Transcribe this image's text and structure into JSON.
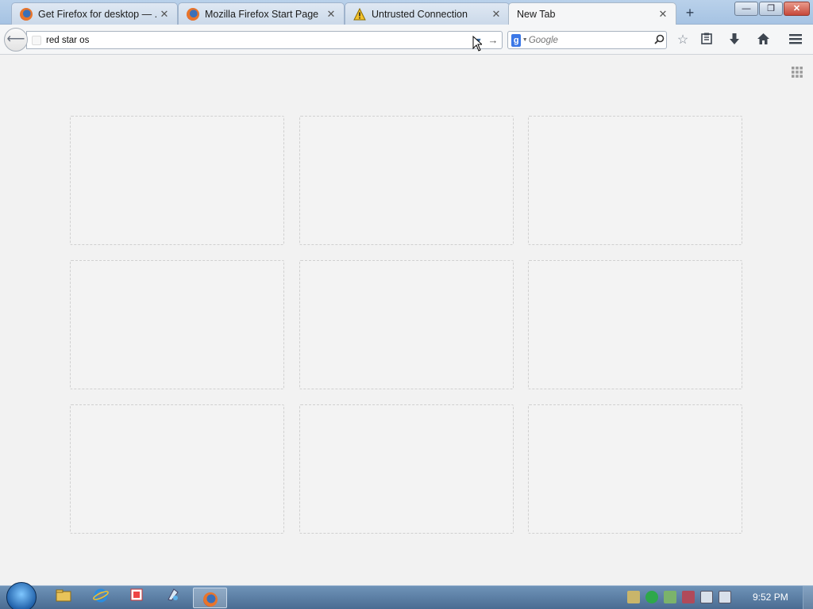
{
  "tabs": [
    {
      "label": "Get Firefox for desktop — ...",
      "icon": "firefox-icon",
      "close": "✕"
    },
    {
      "label": "Mozilla Firefox Start Page",
      "icon": "firefox-icon",
      "close": "✕"
    },
    {
      "label": "Untrusted Connection",
      "icon": "warning-icon",
      "close": "✕"
    },
    {
      "label": "New Tab",
      "icon": "",
      "close": "✕",
      "active": true
    }
  ],
  "new_tab_symbol": "+",
  "window_controls": {
    "minimize": "—",
    "maximize": "❐",
    "close": "✕"
  },
  "navbar": {
    "url_value": "red star os",
    "search_placeholder": "Google",
    "search_engine_letter": "g"
  },
  "tiles_count": 9,
  "taskbar": {
    "clock": "9:52 PM"
  },
  "colors": {
    "accent": "#3b78e7",
    "titlebar": "#b9d1ea",
    "taskbar": "#4a6c92"
  }
}
